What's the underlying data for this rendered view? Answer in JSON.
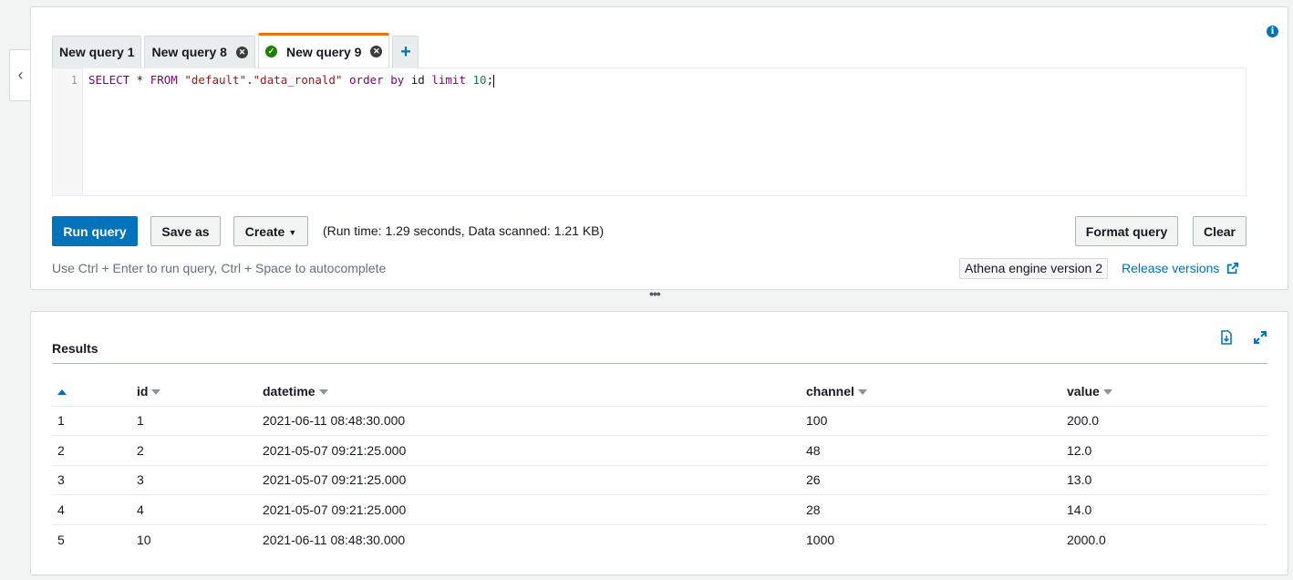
{
  "editor": {
    "tabs": [
      {
        "label": "New query 1",
        "closable": false,
        "active": false
      },
      {
        "label": "New query 8",
        "closable": true,
        "active": false
      },
      {
        "label": "New query 9",
        "closable": true,
        "active": true
      }
    ],
    "add_tab_label": "+",
    "line_number": "1",
    "query": {
      "t1": "SELECT",
      "t2": " * ",
      "t3": "FROM",
      "t4": " ",
      "t5": "\"default\"",
      "t6": ".",
      "t7": "\"data_ronald\"",
      "t8": " ",
      "t9": "order",
      "t10": " ",
      "t11": "by",
      "t12": " id ",
      "t13": "limit",
      "t14": " ",
      "t15": "10",
      "t16": ";"
    },
    "run_label": "Run query",
    "save_label": "Save as",
    "create_label": "Create",
    "runtime_text": "(Run time: 1.29 seconds, Data scanned: 1.21 KB)",
    "format_label": "Format query",
    "clear_label": "Clear",
    "hint": "Use Ctrl + Enter to run query, Ctrl + Space to autocomplete",
    "engine_version": "Athena engine version 2",
    "release_link": "Release versions"
  },
  "results": {
    "title": "Results",
    "columns": [
      "",
      "id",
      "datetime",
      "channel",
      "value"
    ],
    "rows": [
      [
        "1",
        "1",
        "2021-06-11 08:48:30.000",
        "100",
        "200.0"
      ],
      [
        "2",
        "2",
        "2021-05-07 09:21:25.000",
        "48",
        "12.0"
      ],
      [
        "3",
        "3",
        "2021-05-07 09:21:25.000",
        "26",
        "13.0"
      ],
      [
        "4",
        "4",
        "2021-05-07 09:21:25.000",
        "28",
        "14.0"
      ],
      [
        "5",
        "10",
        "2021-06-11 08:48:30.000",
        "1000",
        "2000.0"
      ]
    ]
  },
  "colors": {
    "primary": "#0073bb",
    "active_tab": "#ec7211",
    "success": "#1d8102"
  }
}
